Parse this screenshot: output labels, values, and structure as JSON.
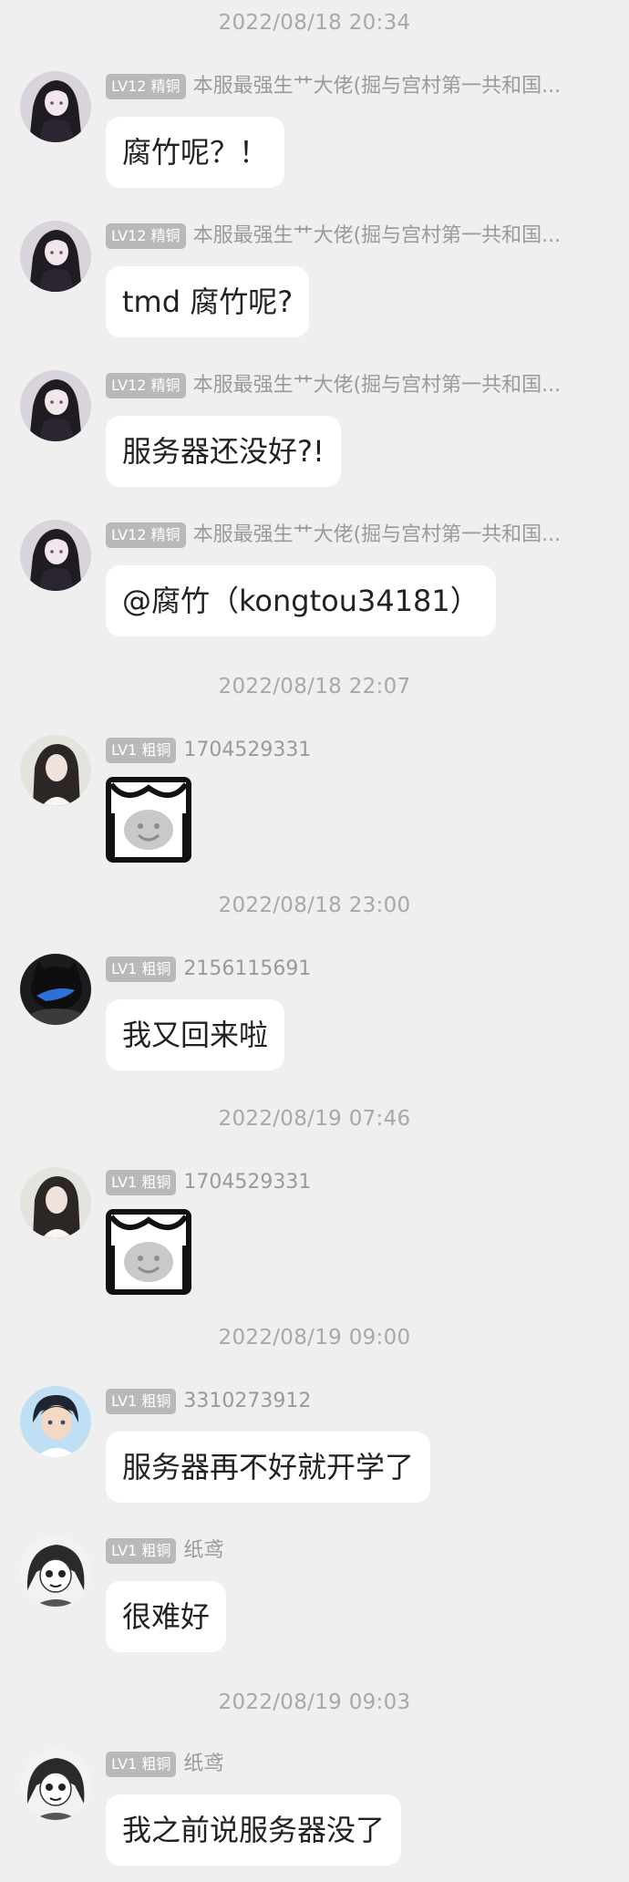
{
  "messages": [
    {
      "time": "2022/08/18 20:34"
    },
    {
      "level": "LV12 精铜",
      "name": "本服最强生艹大佬(掘与宫村第一共和国...",
      "text": "腐竹呢？！",
      "avatar": "anime-girl-dark-hair-avatar"
    },
    {
      "level": "LV12 精铜",
      "name": "本服最强生艹大佬(掘与宫村第一共和国...",
      "text": "tmd 腐竹呢?",
      "avatar": "anime-girl-dark-hair-avatar"
    },
    {
      "level": "LV12 精铜",
      "name": "本服最强生艹大佬(掘与宫村第一共和国...",
      "text": "服务器还没好?!",
      "avatar": "anime-girl-dark-hair-avatar"
    },
    {
      "level": "LV12 精铜",
      "name": "本服最强生艹大佬(掘与宫村第一共和国...",
      "text": "@腐竹（kongtou34181）",
      "avatar": "anime-girl-dark-hair-avatar"
    },
    {
      "time": "2022/08/18 22:07"
    },
    {
      "level": "LV1 粗铜",
      "name": "1704529331",
      "sticker": "moon-face-sticker",
      "avatar": "girl-photo-avatar"
    },
    {
      "time": "2022/08/18 23:00"
    },
    {
      "level": "LV1 粗铜",
      "name": "2156115691",
      "text": "我又回来啦",
      "avatar": "black-cat-avatar"
    },
    {
      "time": "2022/08/19 07:46"
    },
    {
      "level": "LV1 粗铜",
      "name": "1704529331",
      "sticker": "moon-face-sticker",
      "avatar": "girl-photo-avatar"
    },
    {
      "time": "2022/08/19 09:00"
    },
    {
      "level": "LV1 粗铜",
      "name": "3310273912",
      "text": "服务器再不好就开学了",
      "avatar": "anime-boy-avatar"
    },
    {
      "level": "LV1 粗铜",
      "name": "纸鸢",
      "text": "很难好",
      "avatar": "manga-girl-bw-avatar"
    },
    {
      "time": "2022/08/19 09:03"
    },
    {
      "level": "LV1 粗铜",
      "name": "纸鸢",
      "text": "我之前说服务器没了",
      "avatar": "manga-girl-bw-avatar"
    }
  ],
  "colors": {
    "background": "#efefef",
    "bubble": "#ffffff",
    "badge": "#b9b9b9",
    "timestamp": "#a8a8a8",
    "name": "#9a9a9a",
    "text": "#222222"
  }
}
